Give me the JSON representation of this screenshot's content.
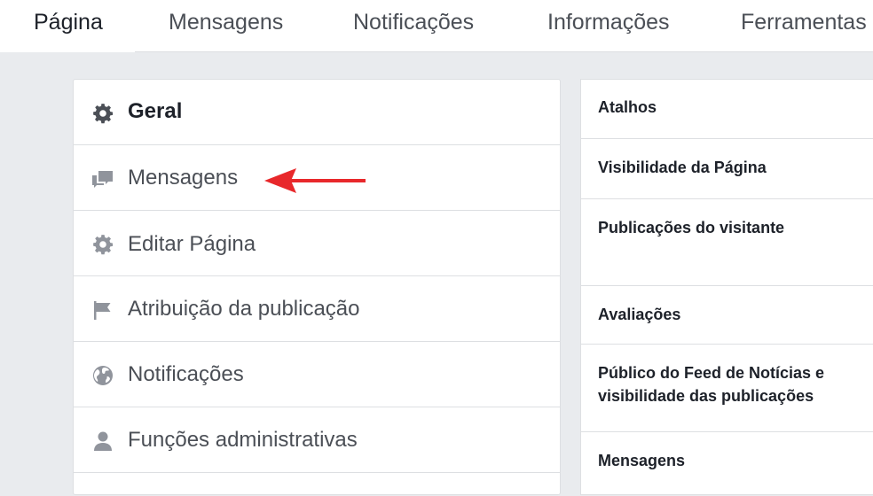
{
  "top_tabs": [
    {
      "label": "Página"
    },
    {
      "label": "Mensagens"
    },
    {
      "label": "Notificações"
    },
    {
      "label": "Informações"
    },
    {
      "label": "Ferramentas"
    }
  ],
  "settings_menu": [
    {
      "label": "Geral",
      "icon": "gear-icon"
    },
    {
      "label": "Mensagens",
      "icon": "messages-icon"
    },
    {
      "label": "Editar Página",
      "icon": "gear-icon"
    },
    {
      "label": "Atribuição da publicação",
      "icon": "flag-icon"
    },
    {
      "label": "Notificações",
      "icon": "globe-icon"
    },
    {
      "label": "Funções administrativas",
      "icon": "person-icon"
    }
  ],
  "general_settings": [
    {
      "label": "Atalhos"
    },
    {
      "label": "Visibilidade da Página"
    },
    {
      "label": "Publicações do visitante"
    },
    {
      "label": "Avaliações"
    },
    {
      "label": "Público do Feed de Notícias e visibilidade das publicações"
    },
    {
      "label": "Mensagens"
    }
  ],
  "colors": {
    "annotation_arrow": "#e8282b",
    "icon_gray": "#90949c"
  }
}
